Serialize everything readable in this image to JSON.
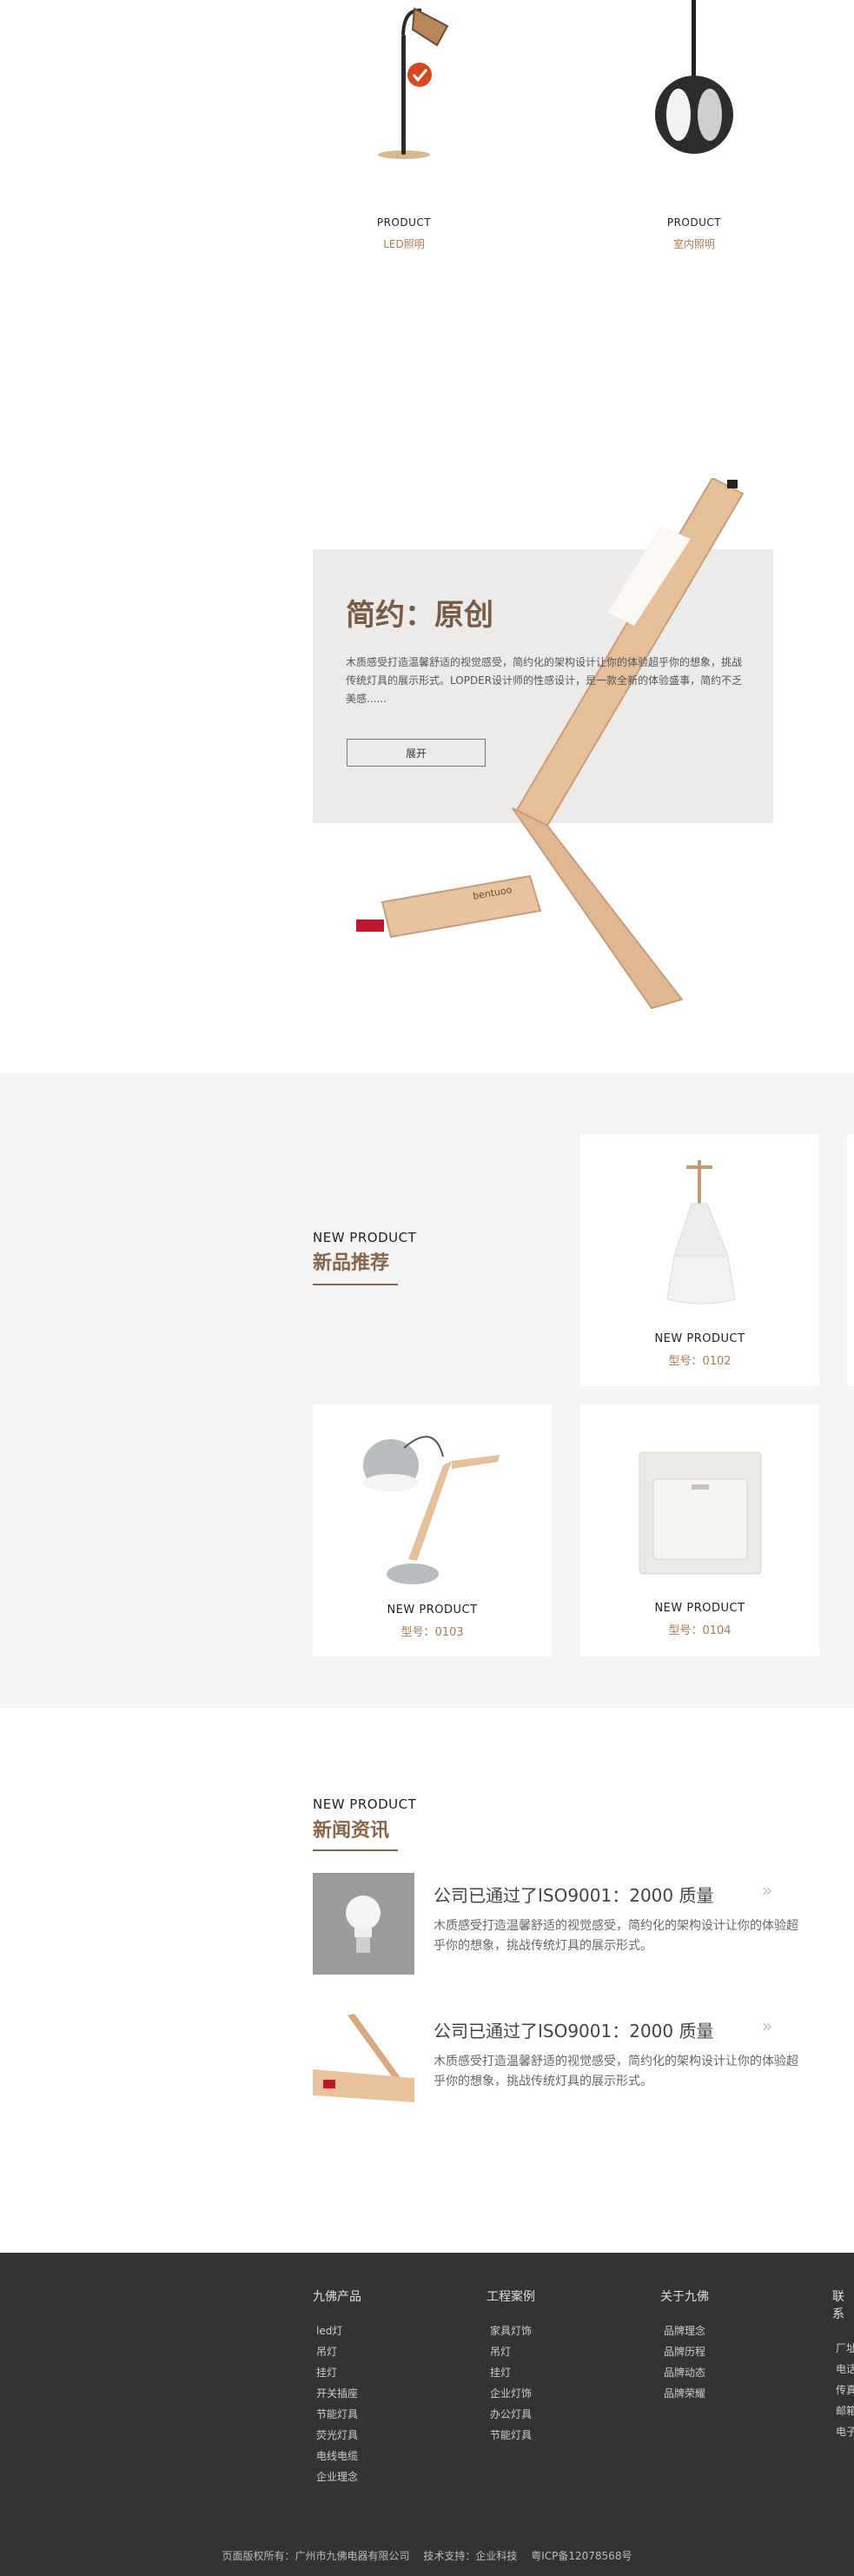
{
  "categories": [
    {
      "en": "PRODUCT",
      "cn": "LED照明",
      "icon": "table-lamp-icon"
    },
    {
      "en": "PRODUCT",
      "cn": "室内照明",
      "icon": "pendant-lamp-icon"
    }
  ],
  "hero": {
    "title": "简约：原创",
    "text": "木质感受打造温馨舒适的视觉感受，简约化的架构设计让你的体验超乎你的想象，挑战传统灯具的展示形式。LOPDER设计师的性感设计，是一款全新的体验盛事，简约不乏美感......",
    "button": "展开",
    "brand_mark": "bentuoo"
  },
  "new_products": {
    "heading_en": "NEW PRODUCT",
    "heading_cn": "新品推荐",
    "items": [
      {
        "en": "NEW PRODUCT",
        "model": "型号：0102",
        "image": "white-pendant-lamp"
      },
      {
        "en": "NEW PRODUCT",
        "model": "型号：0103",
        "image": "wooden-desk-lamp"
      },
      {
        "en": "NEW PRODUCT",
        "model": "型号：0104",
        "image": "wall-switch"
      }
    ]
  },
  "news": {
    "heading_en": "NEW PRODUCT",
    "heading_cn": "新闻资讯",
    "items": [
      {
        "title": "公司已通过了ISO9001：2000 质量",
        "desc": "木质感受打造温馨舒适的视觉感受，简约化的架构设计让你的体验超乎你的想象，挑战传统灯具的展示形式。",
        "image": "light-bulb"
      },
      {
        "title": "公司已通过了ISO9001：2000 质量",
        "desc": "木质感受打造温馨舒适的视觉感受，简约化的架构设计让你的体验超乎你的想象，挑战传统灯具的展示形式。",
        "image": "wooden-lamp"
      }
    ]
  },
  "footer": {
    "columns": [
      {
        "title": "九佛产品",
        "items": [
          "led灯",
          "吊灯",
          "挂灯",
          "开关插座",
          "节能灯具",
          "荧光灯具",
          "电线电缆",
          "企业理念"
        ]
      },
      {
        "title": "工程案例",
        "items": [
          "家具灯饰",
          "吊灯",
          "挂灯",
          "企业灯饰",
          "办公灯具",
          "节能灯具"
        ]
      },
      {
        "title": "关于九佛",
        "items": [
          "品牌理念",
          "品牌历程",
          "品牌动态",
          "品牌荣耀"
        ]
      },
      {
        "title": "联系",
        "items": [
          "厂址",
          "电话",
          "传真",
          "邮箱",
          "电子"
        ]
      }
    ],
    "copyright": "页面版权所有：广州市九佛电器有限公司",
    "tech": "技术支持：企业科技",
    "icp": "粤ICP备12078568号"
  },
  "colors": {
    "accent": "#8a6548",
    "accent_light": "#b07a4f",
    "footer_bg": "#333333",
    "section_bg": "#f4f4f4"
  }
}
